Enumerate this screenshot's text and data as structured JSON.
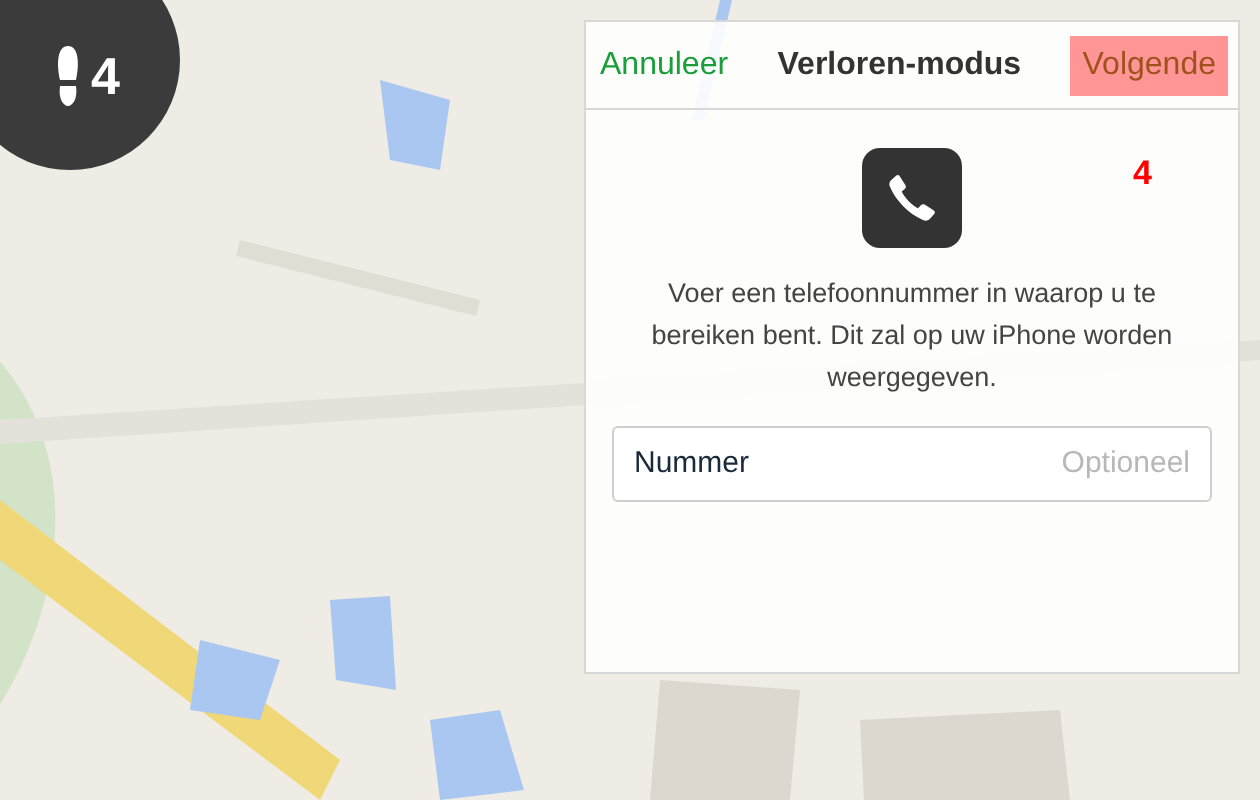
{
  "step_badge": {
    "number": "4"
  },
  "dialog": {
    "cancel": "Annuleer",
    "title": "Verloren-modus",
    "next": {
      "label": "Volgende",
      "highlighted": true
    },
    "annotation": "4",
    "message": "Voer een telefoonnummer in waarop u te bereiken bent. Dit zal op uw iPhone worden weergegeven.",
    "field": {
      "label": "Nummer",
      "placeholder": "Optioneel"
    }
  }
}
